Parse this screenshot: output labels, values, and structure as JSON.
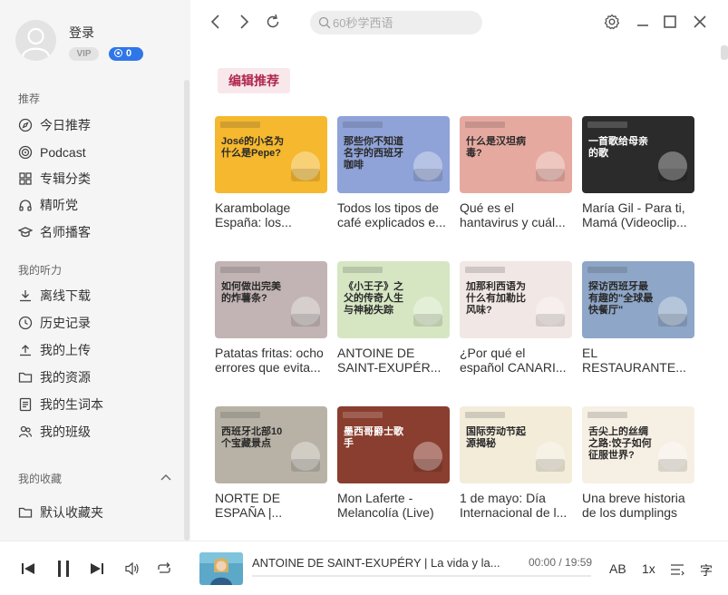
{
  "user": {
    "login_label": "登录",
    "vip_label": "VIP",
    "coins": "0"
  },
  "sidebar": {
    "section_recommend": "推荐",
    "recommend_items": [
      {
        "label": "今日推荐",
        "icon": "compass-icon"
      },
      {
        "label": "Podcast",
        "icon": "podcast-icon"
      },
      {
        "label": "专辑分类",
        "icon": "grid-icon"
      },
      {
        "label": "精听党",
        "icon": "headphones-icon"
      },
      {
        "label": "名师播客",
        "icon": "graduation-cap-icon"
      }
    ],
    "section_listening": "我的听力",
    "listening_items": [
      {
        "label": "离线下载",
        "icon": "download-icon"
      },
      {
        "label": "历史记录",
        "icon": "clock-icon"
      },
      {
        "label": "我的上传",
        "icon": "upload-icon"
      },
      {
        "label": "我的资源",
        "icon": "folder-icon"
      },
      {
        "label": "我的生词本",
        "icon": "notebook-icon"
      },
      {
        "label": "我的班级",
        "icon": "group-icon"
      }
    ],
    "section_favorites": "我的收藏",
    "favorite_items": [
      {
        "label": "默认收藏夹",
        "icon": "folder-icon"
      }
    ]
  },
  "search": {
    "placeholder": "60秒学西语",
    "value": ""
  },
  "content": {
    "section_tag": "编辑推荐",
    "cards": [
      {
        "title": "Karambolage España: los...",
        "thumb": {
          "bg": "#f5b82e",
          "text": "José的小名为什么是Pepe?"
        }
      },
      {
        "title": "Todos los tipos de café explicados e...",
        "thumb": {
          "bg": "#8fa3d8",
          "text": "那些你不知道名字的西班牙咖啡"
        }
      },
      {
        "title": "Qué es el hantavirus y cuál...",
        "thumb": {
          "bg": "#e6a9a0",
          "text": "什么是汉坦病毒?"
        }
      },
      {
        "title": "María Gil - Para ti, Mamá (Videoclip...",
        "thumb": {
          "bg": "#2b2b2b",
          "text": "一首歌给母亲的歌"
        }
      },
      {
        "title": "Patatas fritas: ocho errores que evita...",
        "thumb": {
          "bg": "#c2b4b4",
          "text": "如何做出完美的炸薯条?"
        }
      },
      {
        "title": "ANTOINE DE SAINT-EXUPÉR...",
        "thumb": {
          "bg": "#d6e6c3",
          "text": "《小王子》之父的传奇人生与神秘失踪"
        }
      },
      {
        "title": "¿Por qué el español CANARI...",
        "thumb": {
          "bg": "#f1e7e4",
          "text": "加那利西语为什么有加勒比风味?"
        }
      },
      {
        "title": "EL RESTAURANTE...",
        "thumb": {
          "bg": "#8ea6c7",
          "text": "探访西班牙最有趣的\"全球最快餐厅\""
        }
      },
      {
        "title": "NORTE DE ESPAÑA |...",
        "thumb": {
          "bg": "#b8b2a6",
          "text": "西班牙北部10个宝藏景点"
        }
      },
      {
        "title": "Mon Laferte - Melancolía (Live)",
        "thumb": {
          "bg": "#8a3e2f",
          "text": "墨西哥爵士歌手"
        }
      },
      {
        "title": "1 de mayo: Día Internacional de l...",
        "thumb": {
          "bg": "#f2ecd9",
          "text": "国际劳动节起源揭秘"
        }
      },
      {
        "title": "Una breve historia de los dumplings",
        "thumb": {
          "bg": "#f6efe3",
          "text": "舌尖上的丝绸之路:饺子如何征服世界?"
        }
      }
    ]
  },
  "player": {
    "track_title": "ANTOINE DE SAINT-EXUPÉRY | La vida y la...",
    "current_time": "00:00",
    "duration": "19:59",
    "progress_fraction": 0.0,
    "ab_label": "AB",
    "speed_label": "1x",
    "subtitle_label": "字"
  },
  "colors": {
    "accent": "#e0345a",
    "brand_blue": "#2f76e8",
    "tag_bg": "#f8e8ec",
    "tag_text": "#b0284e"
  }
}
